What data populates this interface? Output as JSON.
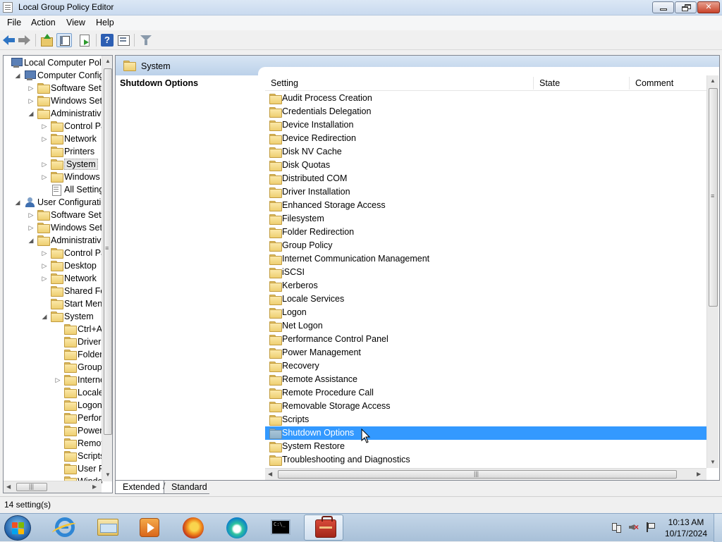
{
  "window": {
    "title": "Local Group Policy Editor"
  },
  "menu": {
    "items": [
      "File",
      "Action",
      "View",
      "Help"
    ]
  },
  "toolbar": {
    "buttons": [
      "back-icon",
      "forward-icon",
      "up-one-level-icon",
      "show-hide-console-tree-icon",
      "export-list-icon",
      "help-icon",
      "properties-icon",
      "filter-icon"
    ]
  },
  "tree": {
    "items": [
      {
        "label": "Local Computer Polic",
        "icon": "computer-policy-icon",
        "expander": ""
      },
      {
        "label": "Computer Config",
        "icon": "computer-icon",
        "expander": "◢"
      },
      {
        "label": "Software Setti",
        "icon": "folder-icon",
        "expander": "▷"
      },
      {
        "label": "Windows Sett",
        "icon": "folder-icon",
        "expander": "▷"
      },
      {
        "label": "Administrative",
        "icon": "folder-icon",
        "expander": "◢"
      },
      {
        "label": "Control Pa",
        "icon": "folder-icon",
        "expander": "▷"
      },
      {
        "label": "Network",
        "icon": "folder-icon",
        "expander": "▷"
      },
      {
        "label": "Printers",
        "icon": "folder-icon",
        "expander": ""
      },
      {
        "label": "System",
        "icon": "folder-icon",
        "expander": "▷",
        "selected": true
      },
      {
        "label": "Windows (",
        "icon": "folder-icon",
        "expander": "▷"
      },
      {
        "label": "All Setting",
        "icon": "settings-page-icon",
        "expander": ""
      },
      {
        "label": "User Configuratio",
        "icon": "user-icon",
        "expander": "◢"
      },
      {
        "label": "Software Setti",
        "icon": "folder-icon",
        "expander": "▷"
      },
      {
        "label": "Windows Sett",
        "icon": "folder-icon",
        "expander": "▷"
      },
      {
        "label": "Administrative",
        "icon": "folder-icon",
        "expander": "◢"
      },
      {
        "label": "Control Pa",
        "icon": "folder-icon",
        "expander": "▷"
      },
      {
        "label": "Desktop",
        "icon": "folder-icon",
        "expander": "▷"
      },
      {
        "label": "Network",
        "icon": "folder-icon",
        "expander": "▷"
      },
      {
        "label": "Shared Fol",
        "icon": "folder-icon",
        "expander": ""
      },
      {
        "label": "Start Menu",
        "icon": "folder-icon",
        "expander": ""
      },
      {
        "label": "System",
        "icon": "folder-icon",
        "expander": "◢"
      },
      {
        "label": "Ctrl+A",
        "icon": "folder-icon",
        "expander": ""
      },
      {
        "label": "Driver I",
        "icon": "folder-icon",
        "expander": ""
      },
      {
        "label": "Folder",
        "icon": "folder-icon",
        "expander": ""
      },
      {
        "label": "Group",
        "icon": "folder-icon",
        "expander": ""
      },
      {
        "label": "Interne",
        "icon": "folder-icon",
        "expander": "▷"
      },
      {
        "label": "Locale",
        "icon": "folder-icon",
        "expander": ""
      },
      {
        "label": "Logon",
        "icon": "folder-icon",
        "expander": ""
      },
      {
        "label": "Perforn",
        "icon": "folder-icon",
        "expander": ""
      },
      {
        "label": "Power",
        "icon": "folder-icon",
        "expander": ""
      },
      {
        "label": "Remov",
        "icon": "folder-icon",
        "expander": ""
      },
      {
        "label": "Scripts",
        "icon": "folder-icon",
        "expander": ""
      },
      {
        "label": "User Pr",
        "icon": "folder-icon",
        "expander": ""
      },
      {
        "label": "Windo",
        "icon": "folder-icon",
        "expander": ""
      }
    ]
  },
  "content": {
    "header": "System",
    "description_title": "Shutdown Options",
    "columns": [
      "Setting",
      "State",
      "Comment"
    ],
    "items": [
      "Audit Process Creation",
      "Credentials Delegation",
      "Device Installation",
      "Device Redirection",
      "Disk NV Cache",
      "Disk Quotas",
      "Distributed COM",
      "Driver Installation",
      "Enhanced Storage Access",
      "Filesystem",
      "Folder Redirection",
      "Group Policy",
      "Internet Communication Management",
      "iSCSI",
      "Kerberos",
      "Locale Services",
      "Logon",
      "Net Logon",
      "Performance Control Panel",
      "Power Management",
      "Recovery",
      "Remote Assistance",
      "Remote Procedure Call",
      "Removable Storage Access",
      "Scripts",
      "Shutdown Options",
      "System Restore",
      "Troubleshooting and Diagnostics"
    ],
    "selected_item": "Shutdown Options"
  },
  "tabs": {
    "extended": "Extended",
    "standard": "Standard"
  },
  "status": {
    "text": "14 setting(s)"
  },
  "taskbar": {
    "apps": [
      "internet-explorer-icon",
      "windows-explorer-icon",
      "media-player-icon",
      "firefox-icon",
      "edge-icon",
      "command-prompt-icon",
      "group-policy-editor-icon"
    ],
    "active_app": "group-policy-editor-icon",
    "time": "10:13 AM",
    "date": "10/17/2024"
  },
  "colors": {
    "selection": "#3399ff",
    "header_bg": "#c9daef",
    "taskbar_bg": "#b4c9de"
  }
}
